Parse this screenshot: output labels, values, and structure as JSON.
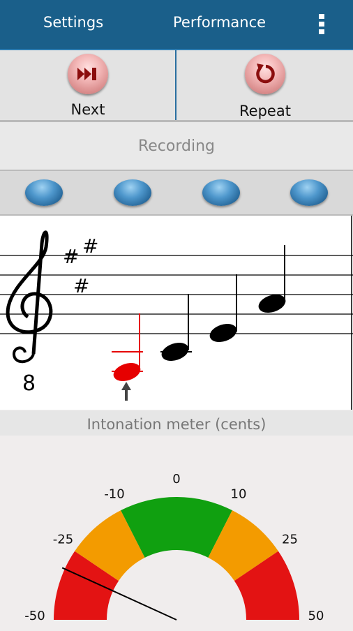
{
  "topbar": {
    "settings_tab": "Settings",
    "performance_tab": "Performance",
    "menu_icon": "overflow-menu-icon"
  },
  "controls": {
    "next": {
      "label": "Next",
      "icon": "skip-next-icon"
    },
    "repeat": {
      "label": "Repeat",
      "icon": "repeat-icon"
    }
  },
  "status": {
    "recording_label": "Recording"
  },
  "indicators": {
    "count": 4,
    "color": "#3f8ac2"
  },
  "staff": {
    "clef": "treble-8vb",
    "clef_octave_mark": "8",
    "key_signature": [
      "#",
      "#",
      "#"
    ],
    "current_note_color": "#e60000",
    "note_color": "#000000"
  },
  "meter": {
    "title": "Intonation meter (cents)",
    "tick_labels": [
      "-50",
      "-25",
      "-10",
      "0",
      "10",
      "25",
      "50"
    ],
    "needle_value_cents": -32,
    "zones": [
      {
        "from": -50,
        "to": -25,
        "color": "#e31313"
      },
      {
        "from": -25,
        "to": -10,
        "color": "#f39b00"
      },
      {
        "from": -10,
        "to": 10,
        "color": "#10a010"
      },
      {
        "from": 10,
        "to": 25,
        "color": "#f39b00"
      },
      {
        "from": 25,
        "to": 50,
        "color": "#e31313"
      }
    ]
  }
}
